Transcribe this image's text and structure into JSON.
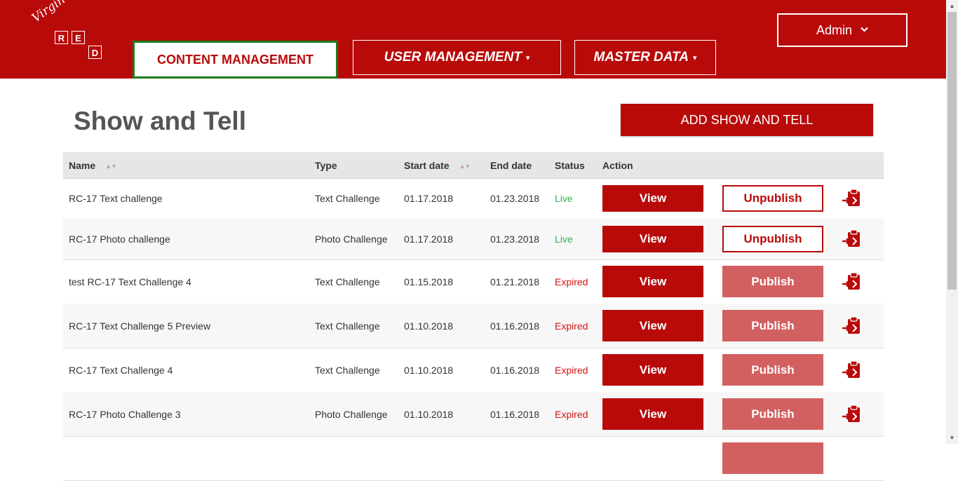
{
  "brand": {
    "script": "Virgin",
    "letters": [
      "R",
      "E",
      "D"
    ]
  },
  "nav": {
    "content_management": "CONTENT MANAGEMENT",
    "user_management": "USER MANAGEMENT",
    "master_data": "MASTER DATA",
    "caret": "▾"
  },
  "user_menu": {
    "label": "Admin",
    "chevron": "❯"
  },
  "page": {
    "title": "Show and Tell",
    "add_button": "ADD SHOW AND TELL"
  },
  "table": {
    "columns": [
      "Name",
      "Type",
      "Start date",
      "End date",
      "Status",
      "Action"
    ],
    "sort_glyph": "▲▼",
    "rows": [
      {
        "name": "RC-17 Text challenge",
        "type": "Text Challenge",
        "start": "01.17.2018",
        "end": "01.23.2018",
        "status": "Live",
        "view": "View",
        "publish": "Unpublish"
      },
      {
        "name": "RC-17 Photo challenge",
        "type": "Photo Challenge",
        "start": "01.17.2018",
        "end": "01.23.2018",
        "status": "Live",
        "view": "View",
        "publish": "Unpublish"
      },
      {
        "name": "test RC-17 Text Challenge 4",
        "type": "Text Challenge",
        "start": "01.15.2018",
        "end": "01.21.2018",
        "status": "Expired",
        "view": "View",
        "publish": "Publish"
      },
      {
        "name": "RC-17 Text Challenge 5 Preview",
        "type": "Text Challenge",
        "start": "01.10.2018",
        "end": "01.16.2018",
        "status": "Expired",
        "view": "View",
        "publish": "Publish"
      },
      {
        "name": "RC-17 Text Challenge 4",
        "type": "Text Challenge",
        "start": "01.10.2018",
        "end": "01.16.2018",
        "status": "Expired",
        "view": "View",
        "publish": "Publish"
      },
      {
        "name": "RC-17 Photo Challenge 3",
        "type": "Photo Challenge",
        "start": "01.10.2018",
        "end": "01.16.2018",
        "status": "Expired",
        "view": "View",
        "publish": "Publish"
      }
    ]
  },
  "colors": {
    "brand_red": "#b90a0a",
    "live": "#33b04b",
    "expired": "#d31515",
    "publish_faded": "#d26060",
    "active_border": "#1e7a1e"
  },
  "icons": {
    "row_action": "clipboard-arrow-icon",
    "admin": "chevron-down-icon",
    "sort": "sort-icon"
  }
}
